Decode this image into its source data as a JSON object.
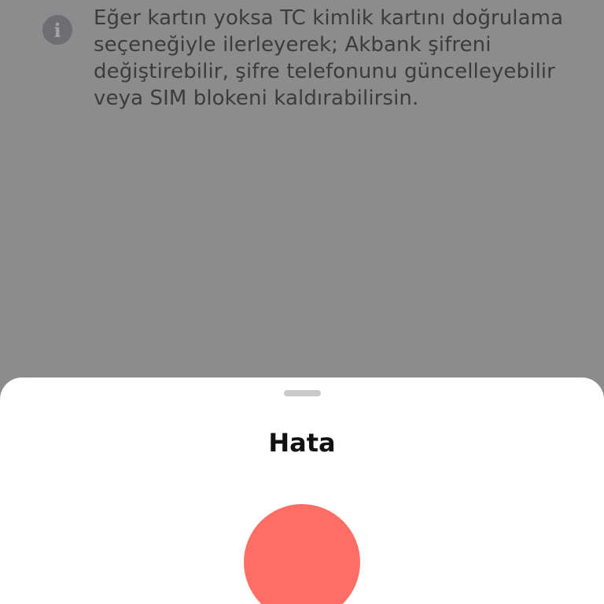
{
  "info": {
    "icon": "info-icon",
    "icon_glyph": "i",
    "text": "Eğer kartın yoksa TC kimlik kartını doğrulama seçeneğiyle ilerleyerek; Akbank şifreni değiştirebilir, şifre telefonunu güncelleyebilir veya SIM blokeni kaldırabilirsin."
  },
  "sheet": {
    "title": "Hata",
    "status_icon": "error-icon",
    "status_color": "#ff6e64"
  },
  "colors": {
    "overlay": "#8c8c8c",
    "sheet_background": "#ffffff"
  }
}
